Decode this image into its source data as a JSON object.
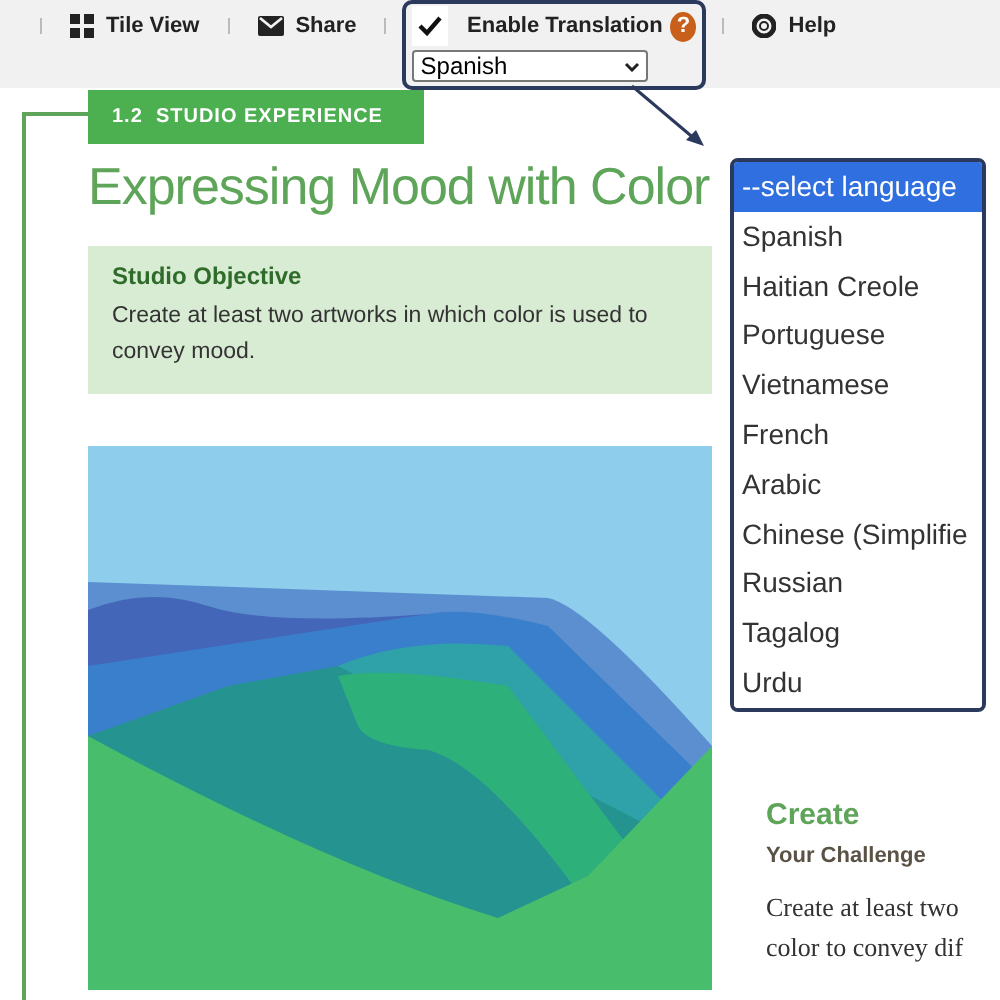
{
  "toolbar": {
    "items": [
      {
        "kind": "tiles",
        "label": "Tile View"
      },
      {
        "kind": "mail",
        "label": "Share"
      },
      {
        "kind": "translation",
        "label": "Enable Translation",
        "checked": true,
        "help": "?",
        "select_value": "Spanish"
      },
      {
        "kind": "help",
        "label": "Help"
      }
    ]
  },
  "section": {
    "badge": "1.2  STUDIO EXPERIENCE",
    "title": "Expressing Mood with Color",
    "objective": {
      "heading": "Studio Objective",
      "text": "Create at least two artworks in which color is used to convey mood."
    },
    "create": {
      "heading": "Create",
      "subheading": "Your Challenge",
      "lines": [
        "Create at least two",
        "color to convey dif"
      ]
    }
  },
  "language_list": {
    "options": [
      {
        "label": "--select language",
        "selected": true
      },
      {
        "label": "Spanish",
        "selected": false
      },
      {
        "label": "Haitian Creole",
        "selected": false
      },
      {
        "label": "Portuguese",
        "selected": false
      },
      {
        "label": "Vietnamese",
        "selected": false
      },
      {
        "label": "French",
        "selected": false
      },
      {
        "label": "Arabic",
        "selected": false
      },
      {
        "label": "Chinese (Simplifie",
        "selected": false
      },
      {
        "label": "Russian",
        "selected": false
      },
      {
        "label": "Tagalog",
        "selected": false
      },
      {
        "label": "Urdu",
        "selected": false
      }
    ]
  }
}
